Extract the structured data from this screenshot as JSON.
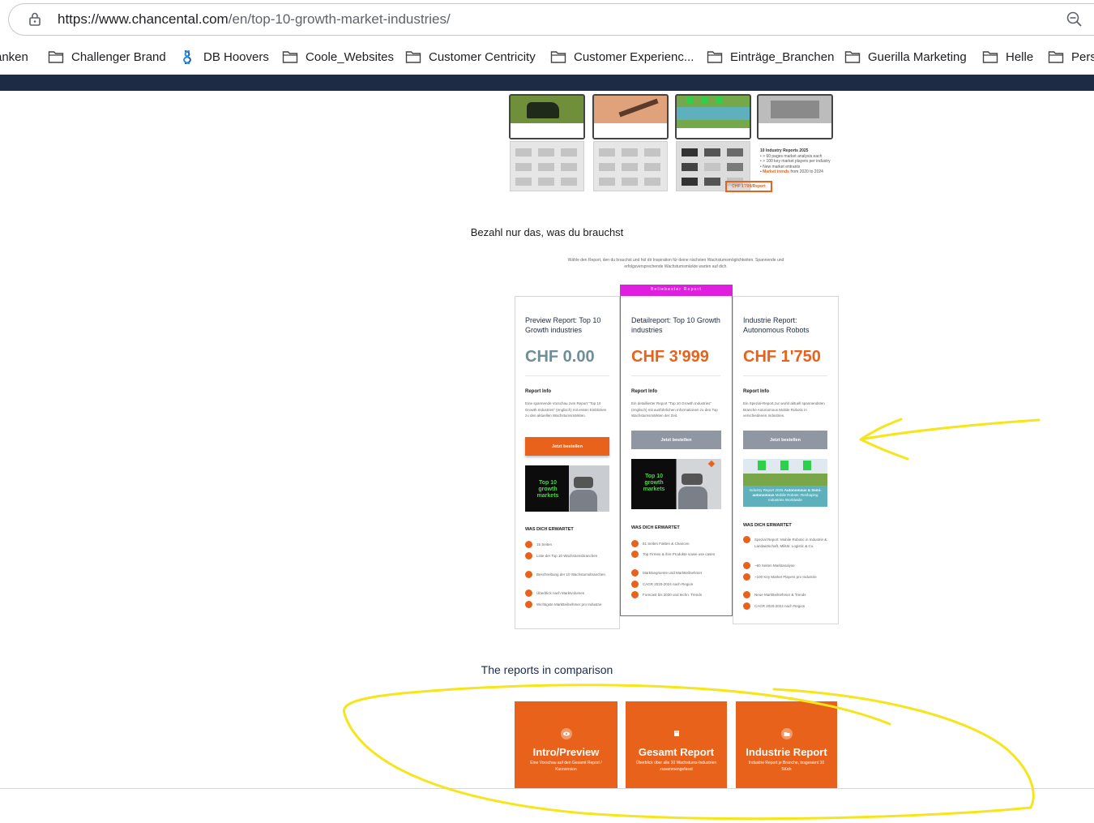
{
  "browser": {
    "url_host": "https://www.chancental.com",
    "url_path": "/en/top-10-growth-market-industries/",
    "bookmarks": [
      {
        "label": "anken",
        "icon": "folder-icon"
      },
      {
        "label": "Challenger Brand",
        "icon": "folder-icon"
      },
      {
        "label": "DB Hoovers",
        "icon": "db-hoovers-logo-icon"
      },
      {
        "label": "Coole_Websites",
        "icon": "folder-icon"
      },
      {
        "label": "Customer Centricity",
        "icon": "folder-icon"
      },
      {
        "label": "Customer Experienc...",
        "icon": "folder-icon"
      },
      {
        "label": "Einträge_Branchen",
        "icon": "folder-icon"
      },
      {
        "label": "Guerilla Marketing",
        "icon": "folder-icon"
      },
      {
        "label": "Helle",
        "icon": "folder-icon"
      },
      {
        "label": "Perso",
        "icon": "folder-icon"
      }
    ]
  },
  "hero": {
    "reports_title": "10 Industry Reports 2025",
    "bullets": [
      "> 60 pages market analysis each",
      "> 100 key market players per industry",
      "New market entrants"
    ],
    "trends_bold": "Market trends",
    "trends_rest": " from 2020 to 2024",
    "price_tag": "CHF 1'799/Report"
  },
  "pricing": {
    "heading": "Bezahl nur das, was du brauchst",
    "subtext": "Wähle den Report, den du brauchst und hol dir Inspiration für deine nächsten Wachstumsmöglichkeiten. Spannende und erfolgsversprechende Wachstumsmärkte warten auf dich.",
    "badge": "Beliebester Report",
    "cards": [
      {
        "title": "Preview Report: Top 10 Growth industries",
        "price": "CHF 0.00",
        "info_label": "Report Info",
        "description": "Eine spannende Vorschau zum Report \"Top 10 Growth Industries\" (englisch) mit ersten Einblicken zu den aktuellen Wachstumsmärkten.",
        "button": "Jetzt bestellen",
        "expect_label": "WAS DICH ERWARTET",
        "features": [
          "15 Seiten",
          "Liste der Top 10 Wachstumsbranchen",
          "Beschreibung der 10 Wachstumsbranchen",
          "Überblick nach Marktvolumen",
          "Wichtigste Marktteilnehmer pro Industrie"
        ]
      },
      {
        "title": "Detailreport: Top 10 Growth industries",
        "price": "CHF 3'999",
        "info_label": "Report Info",
        "description": "Ein detaillierter Report \"Top 10 Growth Industries\" (englisch) mit ausführlichen Informationen zu den Top Wachstumsmärkten der Zeit.",
        "button": "Jetzt bestellen",
        "expect_label": "WAS DICH ERWARTET",
        "features": [
          "81 Seiten Fakten & Chancen",
          "Top Firmen & ihre Produkte sowie use cases",
          "Marktsegmente und Marktteilnehmer",
          "CAGR 2020-2024 nach Region",
          "Forecast bis 2030 und techn. Trends"
        ]
      },
      {
        "title": "Industrie Report: Autonomous  Robots",
        "price": "CHF 1'750",
        "info_label": "Report Info",
        "description": "Ein Spezial-Report zur world aktuell spannendsten Branche Autonomous Mobile Robotic in verschiedenen Industries.",
        "button": "Jetzt bestellen",
        "expect_label": "WAS DICH ERWARTET",
        "features": [
          "Spezial Report: Mobile Robotic in Industrie & Landwirtschaft, Militär, Logistic & Co.",
          "~60 Seiten Marktanalyse",
          "~100 Key Market Players pro Industrie",
          "Neue Marktteilnehmer & Trends",
          "CAGR 2020-2024 nach Region"
        ]
      }
    ]
  },
  "promo": {
    "top10_line1": "Top 10",
    "top10_line2": "growth",
    "top10_line3": "markets",
    "robots_caption_normal": "Industry Report 2025 ",
    "robots_caption_bold": "Autonomous & Semi-autonomous",
    "robots_caption_rest": " Mobile Robots: Reshaping Industries Worldwide"
  },
  "comparison": {
    "heading": "The reports in comparison",
    "tiles": [
      {
        "title": "Intro/Preview",
        "subtitle": "Eine Vorschau auf den Gesamt Report / Kurzversion",
        "icon": "eye-icon"
      },
      {
        "title": "Gesamt Report",
        "subtitle": "Überblick über alle 10 Wachstums-Industrien zusammengefasst",
        "icon": "document-icon"
      },
      {
        "title": "Industrie Report",
        "subtitle": "Industrie Report je Branche, insgesamt 10 Stück",
        "icon": "folder-icon"
      }
    ]
  },
  "colors": {
    "accent_orange": "#e8621b",
    "badge_magenta": "#e01ee0",
    "navbar": "#1d2b45",
    "free_price": "#6e8f9a",
    "annotation_yellow": "#f5e51a"
  }
}
